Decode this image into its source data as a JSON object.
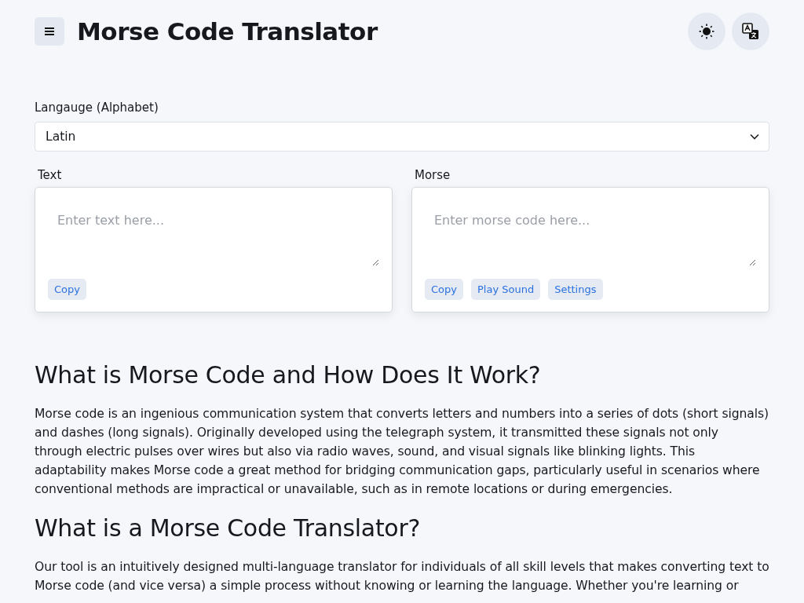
{
  "header": {
    "title": "Morse Code Translator"
  },
  "language": {
    "label": "Langauge (Alphabet)",
    "value": "Latin"
  },
  "panels": [
    {
      "label": "Text",
      "placeholder": "Enter text here...",
      "buttons": [
        "Copy"
      ]
    },
    {
      "label": "Morse",
      "placeholder": "Enter morse code here...",
      "buttons": [
        "Copy",
        "Play Sound",
        "Settings"
      ]
    }
  ],
  "sections": [
    {
      "heading": "What is Morse Code and How Does It Work?",
      "paragraph": "Morse code is an ingenious communication system that converts letters and numbers into a series of dots (short signals) and dashes (long signals). Originally developed using the telegraph system, it transmitted these signals not only through electric pulses over wires but also via radio waves, sound, and visual signals like blinking lights. This adaptability makes Morse code a great method for bridging communication gaps, particularly useful in scenarios where conventional methods are impractical or unavailable, such as in remote locations or during emergencies."
    },
    {
      "heading": "What is a Morse Code Translator?",
      "paragraph": "Our tool is an intuitively designed multi-language translator for individuals of all skill levels that makes converting text to Morse code (and vice versa) a simple process without knowing or learning the language. Whether you're learning or"
    }
  ]
}
